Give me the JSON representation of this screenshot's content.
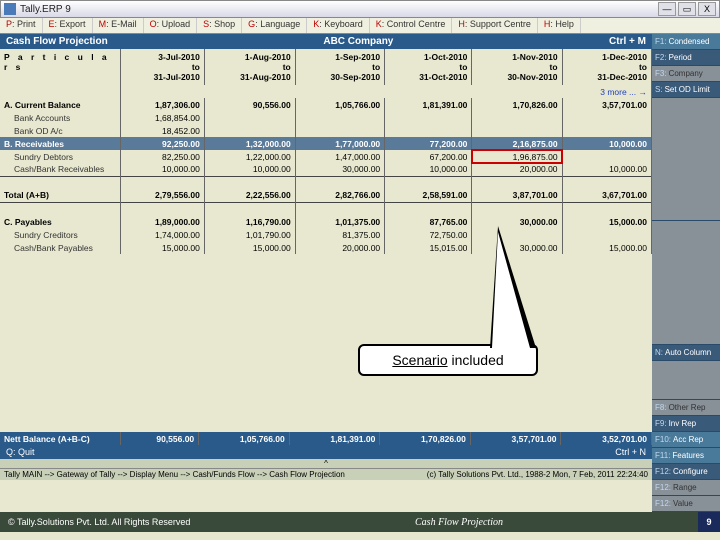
{
  "window": {
    "title": "Tally.ERP 9",
    "min": "—",
    "max": "▭",
    "close": "X"
  },
  "menubar": [
    {
      "k": "P",
      "t": ": Print"
    },
    {
      "k": "E",
      "t": ": Export"
    },
    {
      "k": "M",
      "t": ": E-Mail"
    },
    {
      "k": "O",
      "t": ": Upload"
    },
    {
      "k": "S",
      "t": ": Shop"
    },
    {
      "k": "G",
      "t": ": Language"
    },
    {
      "k": "K",
      "t": ": Keyboard"
    },
    {
      "k": "K",
      "t": ": Control Centre"
    },
    {
      "k": "H",
      "t": ": Support Centre"
    },
    {
      "k": "H",
      "t": ": Help"
    }
  ],
  "sidebar": [
    {
      "f": "F1:",
      "l": "Condensed",
      "c": "c"
    },
    {
      "f": "F2:",
      "l": "Period",
      "c": "n"
    },
    {
      "f": "F3:",
      "l": "Company",
      "c": "g"
    },
    {
      "f": "S:",
      "l": "Set OD Limit",
      "c": "n"
    },
    {
      "f": "",
      "l": "",
      "c": "sp"
    },
    {
      "f": "",
      "l": "",
      "c": "sp"
    },
    {
      "f": "N:",
      "l": "Auto Column",
      "c": "n"
    },
    {
      "f": "",
      "l": "",
      "c": "sp"
    },
    {
      "f": "F8:",
      "l": "Other Rep",
      "c": "g"
    },
    {
      "f": "F9:",
      "l": "Inv Rep",
      "c": "n"
    },
    {
      "f": "F10:",
      "l": "Acc Rep",
      "c": "c"
    },
    {
      "f": "F11:",
      "l": "Features",
      "c": "c"
    },
    {
      "f": "F12:",
      "l": "Configure",
      "c": "n"
    },
    {
      "f": "F12:",
      "l": "Range",
      "c": "g"
    },
    {
      "f": "F12:",
      "l": "Value",
      "c": "g"
    }
  ],
  "report": {
    "title": "Cash Flow Projection",
    "ctrl": "Ctrl + M",
    "company": "ABC Company"
  },
  "columns": [
    {
      "a": "3-Jul-2010",
      "b": "to",
      "c": "31-Jul-2010"
    },
    {
      "a": "1-Aug-2010",
      "b": "to",
      "c": "31-Aug-2010"
    },
    {
      "a": "1-Sep-2010",
      "b": "to",
      "c": "30-Sep-2010"
    },
    {
      "a": "1-Oct-2010",
      "b": "to",
      "c": "31-Oct-2010"
    },
    {
      "a": "1-Nov-2010",
      "b": "to",
      "c": "30-Nov-2010"
    },
    {
      "a": "1-Dec-2010",
      "b": "to",
      "c": "31-Dec-2010"
    }
  ],
  "more": "3 more ... →",
  "rows": {
    "aHead": "A. Current Balance",
    "a": [
      "1,87,306.00",
      "90,556.00",
      "1,05,766.00",
      "1,81,391.00",
      "1,70,826.00",
      "3,57,701.00"
    ],
    "a1l": "Bank Accounts",
    "a1": [
      "1,68,854.00",
      "",
      "",
      "",
      "",
      ""
    ],
    "a2l": "Bank OD A/c",
    "a2": [
      "18,452.00",
      "",
      "",
      "",
      "",
      ""
    ],
    "bHead": "B. Receivables",
    "b": [
      "92,250.00",
      "1,32,000.00",
      "1,77,000.00",
      "77,200.00",
      "2,16,875.00",
      "10,000.00"
    ],
    "b1l": "Sundry Debtors",
    "b1": [
      "82,250.00",
      "1,22,000.00",
      "1,47,000.00",
      "67,200.00",
      "1,96,875.00",
      ""
    ],
    "b2l": "Cash/Bank Receivables",
    "b2": [
      "10,000.00",
      "10,000.00",
      "30,000.00",
      "10,000.00",
      "20,000.00",
      "10,000.00"
    ],
    "totABl": "Total (A+B)",
    "totAB": [
      "2,79,556.00",
      "2,22,556.00",
      "2,82,766.00",
      "2,58,591.00",
      "3,87,701.00",
      "3,67,701.00"
    ],
    "cHead": "C. Payables",
    "c": [
      "1,89,000.00",
      "1,16,790.00",
      "1,01,375.00",
      "87,765.00",
      "30,000.00",
      "15,000.00"
    ],
    "c1l": "Sundry Creditors",
    "c1": [
      "1,74,000.00",
      "1,01,790.00",
      "81,375.00",
      "72,750.00",
      "",
      ""
    ],
    "c2l": "Cash/Bank Payables",
    "c2": [
      "15,000.00",
      "15,000.00",
      "20,000.00",
      "15,015.00",
      "30,000.00",
      "15,000.00"
    ],
    "nettl": "Nett Balance (A+B-C)",
    "nett": [
      "90,556.00",
      "1,05,766.00",
      "1,81,391.00",
      "1,70,826.00",
      "3,57,701.00",
      "3,52,701.00"
    ]
  },
  "callout": "Scenario included",
  "quit": {
    "l": "Q: Quit",
    "r": "Ctrl + N"
  },
  "nav": {
    "path": "Tally MAIN --> Gateway of Tally --> Display Menu --> Cash/Funds Flow --> Cash Flow Projection",
    "copy": "(c) Tally Solutions Pvt. Ltd., 1988-2",
    "date": "Mon, 7 Feb, 2011",
    "time": "22:24:40"
  },
  "footer": {
    "copy": "© Tally.Solutions Pvt. Ltd. All Rights Reserved",
    "title": "Cash Flow Projection",
    "page": "9"
  }
}
